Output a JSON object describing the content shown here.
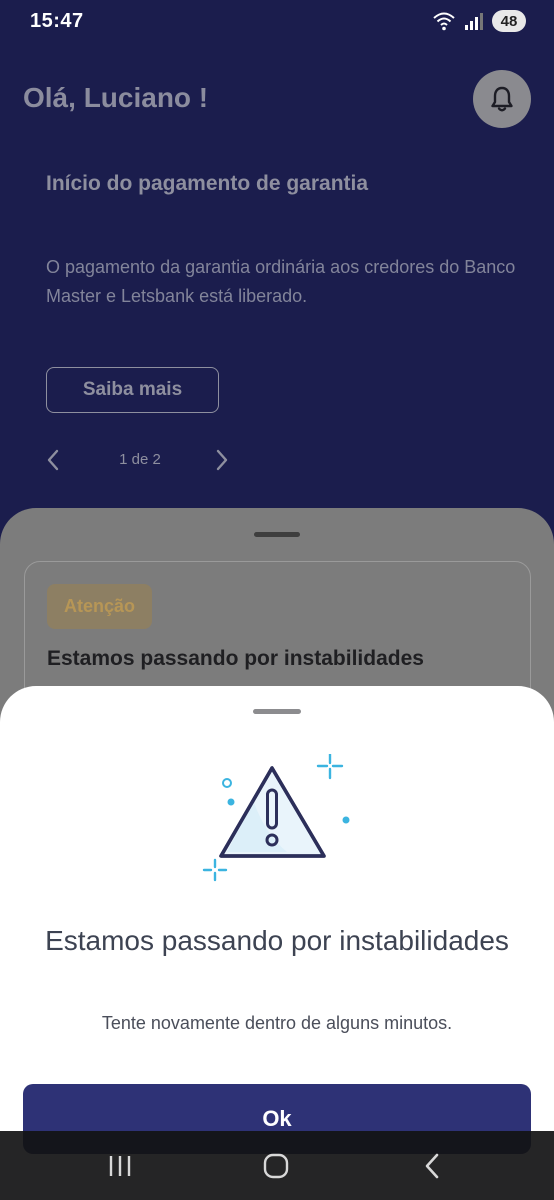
{
  "status_bar": {
    "time": "15:47",
    "battery": "48",
    "icons": [
      "wifi-icon",
      "signal-icon"
    ]
  },
  "header": {
    "greeting": "Olá, Luciano !",
    "bell_icon": "bell-icon"
  },
  "banner": {
    "title": "Início do pagamento de garantia",
    "text": "O pagamento da garantia ordinária aos credores do Banco Master e Letsbank está liberado.",
    "button_label": "Saiba mais",
    "pager": {
      "label": "1 de 2",
      "prev_icon": "chevron-left-icon",
      "next_icon": "chevron-right-icon"
    }
  },
  "alert_card": {
    "badge": "Atenção",
    "title": "Estamos passando por instabilidades"
  },
  "modal": {
    "illustration": "warning-triangle-icon",
    "title": "Estamos passando por instabilidades",
    "subtitle": "Tente novamente dentro de alguns minutos.",
    "ok_label": "Ok"
  },
  "nav_bar": {
    "icons": [
      "recent-apps-icon",
      "home-icon",
      "back-icon"
    ]
  },
  "colors": {
    "background": "#1b1d4d",
    "primary_button": "#2e3276",
    "illustration_accent": "#3bb4e0",
    "warning_badge_text": "#b79656"
  }
}
